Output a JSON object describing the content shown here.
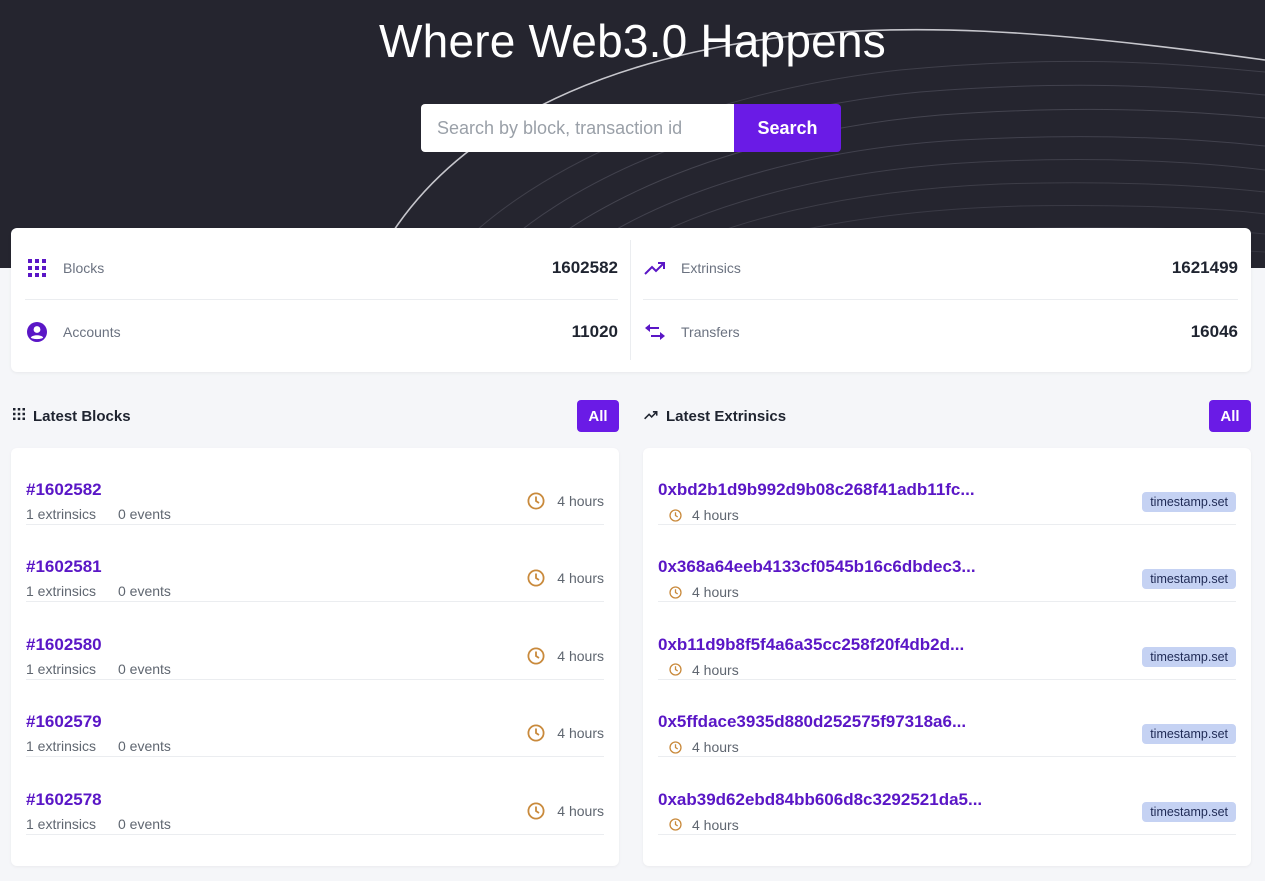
{
  "hero": {
    "title": "Where Web3.0 Happens",
    "search_placeholder": "Search by block, transaction id",
    "search_label": "Search"
  },
  "stats": {
    "blocks": {
      "label": "Blocks",
      "value": "1602582",
      "icon": "grid-icon"
    },
    "extrinsics": {
      "label": "Extrinsics",
      "value": "1621499",
      "icon": "trending-up-icon"
    },
    "accounts": {
      "label": "Accounts",
      "value": "11020",
      "icon": "account-circle-icon"
    },
    "transfers": {
      "label": "Transfers",
      "value": "16046",
      "icon": "swap-arrows-icon"
    }
  },
  "latest_blocks": {
    "title": "Latest Blocks",
    "all_label": "All",
    "rows": [
      {
        "number": "#1602582",
        "extrinsics": "1 extrinsics",
        "events": "0 events",
        "time": "4 hours"
      },
      {
        "number": "#1602581",
        "extrinsics": "1 extrinsics",
        "events": "0 events",
        "time": "4 hours"
      },
      {
        "number": "#1602580",
        "extrinsics": "1 extrinsics",
        "events": "0 events",
        "time": "4 hours"
      },
      {
        "number": "#1602579",
        "extrinsics": "1 extrinsics",
        "events": "0 events",
        "time": "4 hours"
      },
      {
        "number": "#1602578",
        "extrinsics": "1 extrinsics",
        "events": "0 events",
        "time": "4 hours"
      }
    ]
  },
  "latest_extrinsics": {
    "title": "Latest Extrinsics",
    "all_label": "All",
    "rows": [
      {
        "hash": "0xbd2b1d9b992d9b08c268f41adb11fc...",
        "time": "4 hours",
        "method": "timestamp.set"
      },
      {
        "hash": "0x368a64eeb4133cf0545b16c6dbdec3...",
        "time": "4 hours",
        "method": "timestamp.set"
      },
      {
        "hash": "0xb11d9b8f5f4a6a35cc258f20f4db2d...",
        "time": "4 hours",
        "method": "timestamp.set"
      },
      {
        "hash": "0x5ffdace3935d880d252575f97318a6...",
        "time": "4 hours",
        "method": "timestamp.set"
      },
      {
        "hash": "0xab39d62ebd84bb606d8c3292521da5...",
        "time": "4 hours",
        "method": "timestamp.set"
      }
    ]
  },
  "colors": {
    "accent": "#6a1be6",
    "link": "#5a16c6",
    "hero_bg": "#25252f",
    "clock": "#c98a3c",
    "badge_bg": "#c5d2f3"
  }
}
